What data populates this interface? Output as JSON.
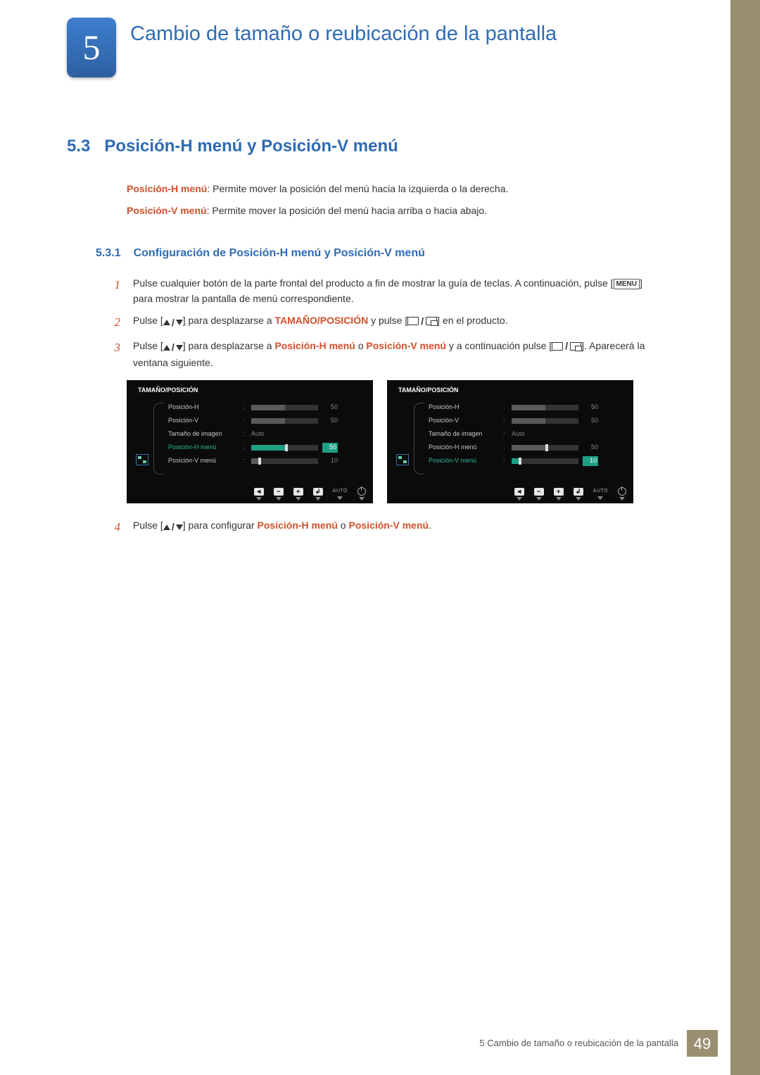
{
  "chapter": {
    "number": "5",
    "title": "Cambio de tamaño o reubicación de la pantalla"
  },
  "section": {
    "number": "5.3",
    "title": "Posición-H menú y Posición-V menú"
  },
  "intro": {
    "h_label": "Posición-H menú",
    "h_desc": ": Permite mover la posición del menú hacia la izquierda o la derecha.",
    "v_label": "Posición-V menú",
    "v_desc": ": Permite mover la posición del menú hacia arriba o hacia abajo."
  },
  "subheading": {
    "number": "5.3.1",
    "title": "Configuración de Posición-H menú y Posición-V menú"
  },
  "steps": {
    "s1_num": "1",
    "s1_a": "Pulse cualquier botón de la parte frontal del producto a fin de mostrar la guía de teclas. A continuación, pulse [",
    "s1_menu": "MENU",
    "s1_b": "] para mostrar la pantalla de menú correspondiente.",
    "s2_num": "2",
    "s2_a": "Pulse [",
    "s2_b": "] para desplazarse a ",
    "s2_kw": "TAMAÑO/POSICIÓN",
    "s2_c": " y pulse [",
    "s2_d": "] en el producto.",
    "s3_num": "3",
    "s3_a": "Pulse [",
    "s3_b": "] para desplazarse a ",
    "s3_kw1": "Posición-H menú",
    "s3_or1": " o ",
    "s3_kw2": "Posición-V menú",
    "s3_c": " y a continuación pulse [",
    "s3_d": "]. Aparecerá la ventana siguiente.",
    "s4_num": "4",
    "s4_a": "Pulse [",
    "s4_b": "] para configurar ",
    "s4_kw1": "Posición-H menú",
    "s4_or": " o ",
    "s4_kw2": "Posición-V menú",
    "s4_c": "."
  },
  "osd": {
    "title": "TAMAÑO/POSICIÓN",
    "items": {
      "pos_h": "Posición-H",
      "pos_v": "Posición-V",
      "img_size": "Tamaño de imagen",
      "auto": "Auto",
      "menu_h": "Posición-H menú",
      "menu_v": "Posición-V menú"
    },
    "values": {
      "pos_h": "50",
      "pos_v": "50",
      "menu_h": "50",
      "menu_v_empty": "10",
      "menu_v_active": "10"
    },
    "btnbar": {
      "back": "◄",
      "minus": "−",
      "plus": "+",
      "enter": "↲",
      "auto": "AUTO"
    }
  },
  "footer": {
    "text": "5 Cambio de tamaño o reubicación de la pantalla",
    "page": "49"
  }
}
